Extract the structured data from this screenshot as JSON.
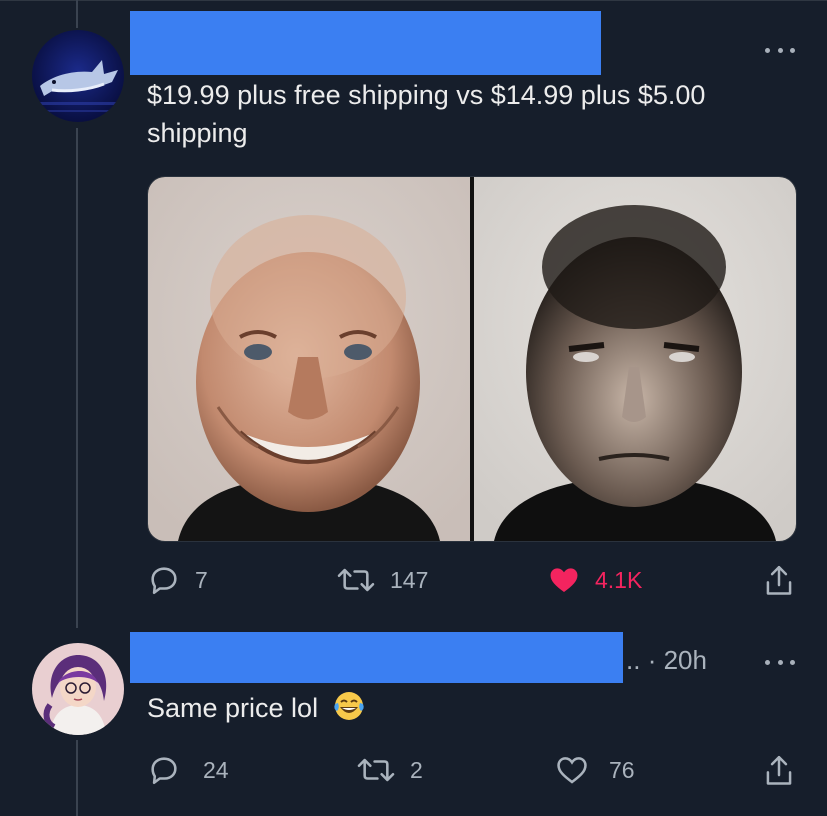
{
  "tweet": {
    "text": "$19.99 plus free shipping vs $14.99 plus $5.00 shipping",
    "actions": {
      "reply_count": "7",
      "retweet_count": "147",
      "like_count": "4.1K"
    },
    "colors": {
      "like_active": "#f4245f",
      "accent": "#3b7ff2"
    },
    "icons": [
      "reply-icon",
      "retweet-icon",
      "heart-filled-icon",
      "share-icon",
      "more-icon"
    ]
  },
  "reply": {
    "name_truncation": "..",
    "time": "· 20h",
    "text": "Same price lol",
    "emoji": "😂",
    "actions": {
      "reply_count": "24",
      "retweet_count": "2",
      "like_count": "76"
    },
    "icons": [
      "reply-icon",
      "retweet-icon",
      "heart-outline-icon",
      "share-icon",
      "more-icon"
    ]
  }
}
